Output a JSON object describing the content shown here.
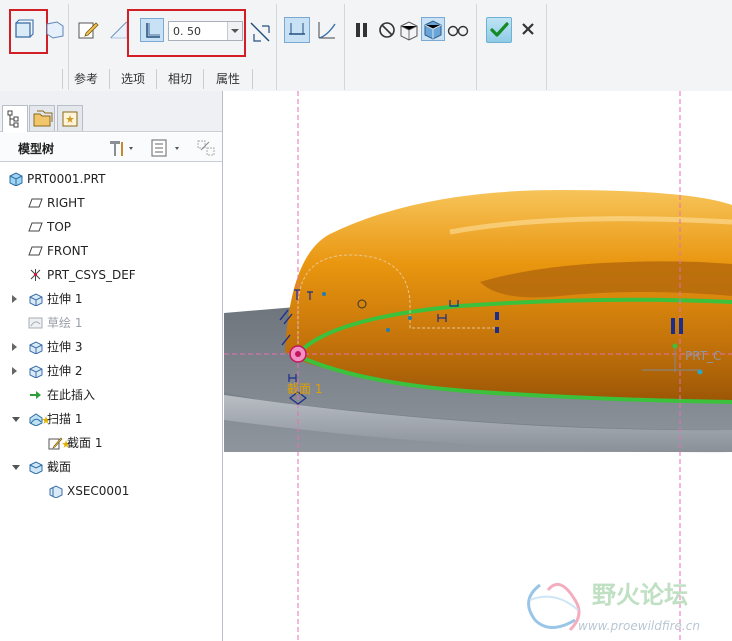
{
  "ribbon": {
    "thickness_value": "0. 50",
    "tabs": [
      "参考",
      "选项",
      "相切",
      "属性"
    ],
    "tools": [
      "solid-icon",
      "surface-icon",
      "sketch-edit-icon",
      "remove-material-icon",
      "thin-feature-icon",
      "flip-thickness-icon",
      "sweep-type-constant-icon",
      "sweep-type-variable-icon",
      "pause-icon",
      "no-preview-icon",
      "preview-mesh-icon",
      "preview-solid-icon",
      "verify-glasses-icon",
      "ok-check-icon",
      "cancel-x-icon"
    ]
  },
  "colors": {
    "selection_highlight": "#d21f26",
    "model_orange": "#e08a10",
    "trajectory_green": "#3cc13c",
    "datum_line": "#e46fb5",
    "base_plate": "#8c939b"
  },
  "panel": {
    "title": "模型树",
    "tree": [
      {
        "label": "PRT0001.PRT",
        "icon": "part-icon",
        "expander": "none",
        "indent": 0
      },
      {
        "label": "RIGHT",
        "icon": "datum-plane-icon",
        "expander": "none",
        "indent": 1
      },
      {
        "label": "TOP",
        "icon": "datum-plane-icon",
        "expander": "none",
        "indent": 1
      },
      {
        "label": "FRONT",
        "icon": "datum-plane-icon",
        "expander": "none",
        "indent": 1
      },
      {
        "label": "PRT_CSYS_DEF",
        "icon": "csys-icon",
        "expander": "none",
        "indent": 1
      },
      {
        "label": "拉伸 1",
        "icon": "extrude-icon",
        "expander": "closed",
        "indent": 1
      },
      {
        "label": "草绘 1",
        "icon": "sketch-icon",
        "expander": "none",
        "indent": 1,
        "dim": true
      },
      {
        "label": "拉伸 3",
        "icon": "extrude-icon",
        "expander": "closed",
        "indent": 1
      },
      {
        "label": "拉伸 2",
        "icon": "extrude-icon",
        "expander": "closed",
        "indent": 1
      },
      {
        "label": "在此插入",
        "icon": "insert-here-icon",
        "expander": "none",
        "indent": 1
      },
      {
        "label": "扫描 1",
        "icon": "sweep-icon",
        "expander": "open",
        "indent": 1
      },
      {
        "label": "截面 1",
        "icon": "section-sketch-icon",
        "expander": "none",
        "indent": 2
      },
      {
        "label": "截面",
        "icon": "section-folder-icon",
        "expander": "open",
        "indent": 1
      },
      {
        "label": "XSEC0001",
        "icon": "xsec-icon",
        "expander": "none",
        "indent": 2
      }
    ]
  },
  "viewport": {
    "section_label": "截面 1",
    "csys_label": "PRT_C",
    "watermark_title": "野火论坛",
    "watermark_url": "www.proewildfire.cn"
  }
}
